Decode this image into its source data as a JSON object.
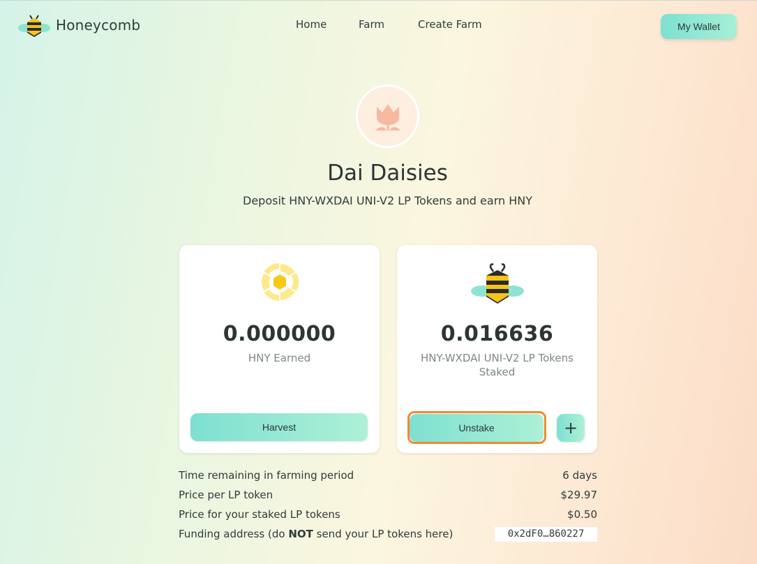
{
  "header": {
    "brand_name": "Honeycomb",
    "nav": [
      "Home",
      "Farm",
      "Create Farm"
    ],
    "wallet_label": "My Wallet"
  },
  "farm": {
    "title": "Dai Daisies",
    "subtitle": "Deposit HNY-WXDAI UNI-V2 LP Tokens and earn HNY",
    "logo_icon": "tulip-icon"
  },
  "earned_card": {
    "icon": "honeycomb-coin-icon",
    "value": "0.000000",
    "label": "HNY Earned",
    "button": "Harvest"
  },
  "staked_card": {
    "icon": "bee-icon",
    "value": "0.016636",
    "label": "HNY-WXDAI UNI-V2 LP Tokens Staked",
    "button": "Unstake",
    "plus_label": "+"
  },
  "info": {
    "time_label": "Time remaining in farming period",
    "time_value": "6 days",
    "price_lp_label": "Price per LP token",
    "price_lp_value": "$29.97",
    "price_staked_label": "Price for your staked LP tokens",
    "price_staked_value": "$0.50",
    "funding_prefix": "Funding address (do ",
    "funding_bold": "NOT",
    "funding_suffix": " send your LP tokens here)",
    "funding_address": "0x2dF0…860227"
  },
  "colors": {
    "accent_start": "#7ee0d1",
    "accent_end": "#adf0d6",
    "highlight": "#f08a2c",
    "bee_yellow": "#f5c518"
  }
}
